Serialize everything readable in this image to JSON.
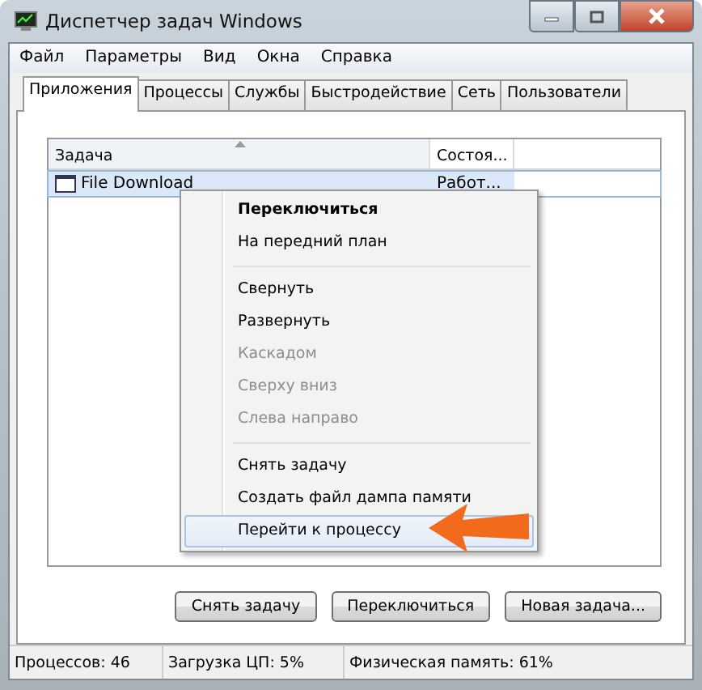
{
  "window": {
    "title": "Диспетчер задач Windows"
  },
  "menu_bar": [
    "Файл",
    "Параметры",
    "Вид",
    "Окна",
    "Справка"
  ],
  "tabs": [
    {
      "label": "Приложения",
      "selected": true
    },
    {
      "label": "Процессы",
      "selected": false
    },
    {
      "label": "Службы",
      "selected": false
    },
    {
      "label": "Быстродействие",
      "selected": false
    },
    {
      "label": "Сеть",
      "selected": false
    },
    {
      "label": "Пользователи",
      "selected": false
    }
  ],
  "table": {
    "columns": [
      "Задача",
      "Состоя..."
    ],
    "rows": [
      {
        "task": "File Download",
        "status": "Работ...",
        "selected": true
      }
    ]
  },
  "context_menu": [
    {
      "kind": "item",
      "label": "Переключиться",
      "default": true,
      "disabled": false,
      "selected": false
    },
    {
      "kind": "item",
      "label": "На передний план",
      "default": false,
      "disabled": false,
      "selected": false
    },
    {
      "kind": "separator"
    },
    {
      "kind": "item",
      "label": "Свернуть",
      "default": false,
      "disabled": false,
      "selected": false
    },
    {
      "kind": "item",
      "label": "Развернуть",
      "default": false,
      "disabled": false,
      "selected": false
    },
    {
      "kind": "item",
      "label": "Каскадом",
      "default": false,
      "disabled": true,
      "selected": false
    },
    {
      "kind": "item",
      "label": "Сверху вниз",
      "default": false,
      "disabled": true,
      "selected": false
    },
    {
      "kind": "item",
      "label": "Слева направо",
      "default": false,
      "disabled": true,
      "selected": false
    },
    {
      "kind": "separator"
    },
    {
      "kind": "item",
      "label": "Снять задачу",
      "default": false,
      "disabled": false,
      "selected": false
    },
    {
      "kind": "item",
      "label": "Создать файл дампа памяти",
      "default": false,
      "disabled": false,
      "selected": false
    },
    {
      "kind": "item",
      "label": "Перейти к процессу",
      "default": false,
      "disabled": false,
      "selected": true
    }
  ],
  "buttons": [
    "Снять задачу",
    "Переключиться",
    "Новая задача..."
  ],
  "status_bar": [
    "Процессов: 46",
    "Загрузка ЦП: 5%",
    "Физическая память: 61%"
  ]
}
